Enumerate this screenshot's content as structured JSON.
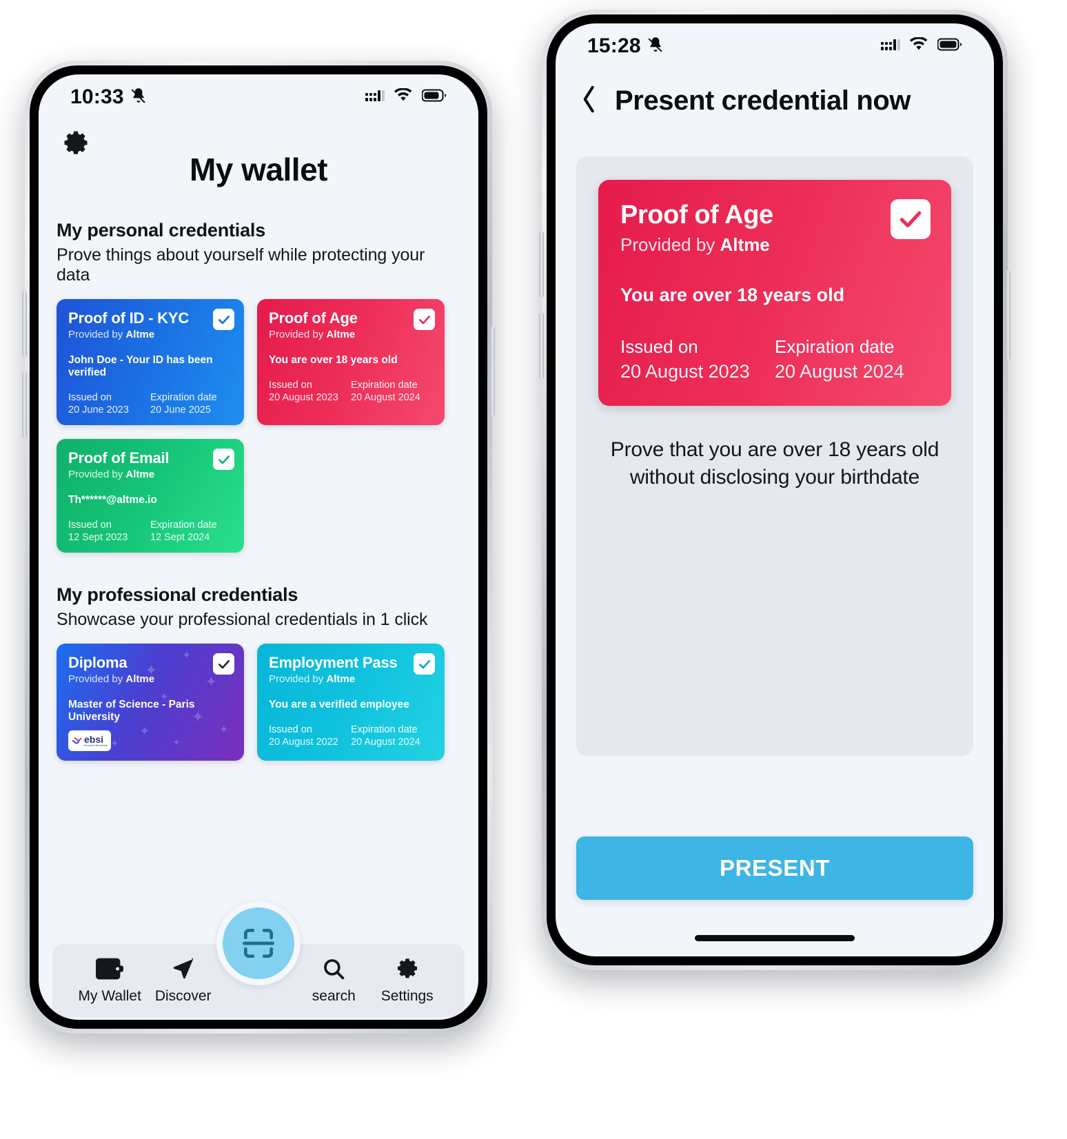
{
  "phone1": {
    "status_bar": {
      "time": "10:33",
      "icons": [
        "bell-muted-icon",
        "cellular-signal-icon",
        "wifi-icon",
        "battery-icon"
      ]
    },
    "settings_icon": "gear-icon",
    "title": "My wallet",
    "sections": [
      {
        "heading": "My personal credentials",
        "subheading": "Prove things about yourself while protecting your data",
        "cards": [
          {
            "title": "Proof of ID - KYC",
            "provider_prefix": "Provided by ",
            "provider": "Altme",
            "claim": "John Doe - Your ID has been verified",
            "issued_label": "Issued on",
            "issued_value": "20 June 2023",
            "expiration_label": "Expiration date",
            "expiration_value": "20 June 2025",
            "theme": "blue",
            "accent": "#1b6fe2",
            "checked": true
          },
          {
            "title": "Proof of Age",
            "provider_prefix": "Provided by ",
            "provider": "Altme",
            "claim": "You are over 18 years old",
            "issued_label": "Issued on",
            "issued_value": "20 August 2023",
            "expiration_label": "Expiration date",
            "expiration_value": "20 August 2024",
            "theme": "red",
            "accent": "#ec2c56",
            "checked": true
          },
          {
            "title": "Proof of Email",
            "provider_prefix": "Provided by ",
            "provider": "Altme",
            "claim": "Th******@altme.io",
            "issued_label": "Issued on",
            "issued_value": "12 Sept 2023",
            "expiration_label": "Expiration date",
            "expiration_value": "12 Sept 2024",
            "theme": "green",
            "accent": "#14c377",
            "checked": true
          }
        ]
      },
      {
        "heading": "My professional credentials",
        "subheading": "Showcase your professional credentials in 1 click",
        "cards": [
          {
            "title": "Diploma",
            "provider_prefix": "Provided by ",
            "provider": "Altme",
            "claim": "Master of Science - Paris University",
            "badge": "ebsi",
            "badge_sub": "European Blockchain",
            "theme": "purple",
            "accent": "#4a3fd0",
            "checked": true
          },
          {
            "title": "Employment Pass",
            "provider_prefix": "Provided by ",
            "provider": "Altme",
            "claim": "You are a verified employee",
            "issued_label": "Issued on",
            "issued_value": "20 August 2022",
            "expiration_label": "Expiration date",
            "expiration_value": "20 August 2024",
            "theme": "cyan",
            "accent": "#10c2de",
            "checked": true
          }
        ]
      }
    ],
    "bottom_nav": {
      "items": [
        {
          "label": "My Wallet",
          "icon": "wallet-icon",
          "active": true
        },
        {
          "label": "Discover",
          "icon": "paper-plane-icon",
          "active": false
        },
        {
          "label": "search",
          "icon": "magnifier-icon",
          "active": false
        },
        {
          "label": "Settings",
          "icon": "gear-icon",
          "active": false
        }
      ],
      "fab": {
        "icon": "qr-scan-icon",
        "color": "#83d0f0"
      }
    }
  },
  "phone2": {
    "status_bar": {
      "time": "15:28",
      "icons": [
        "bell-muted-icon",
        "cellular-signal-icon",
        "wifi-icon",
        "battery-icon"
      ]
    },
    "back_icon": "chevron-left-icon",
    "title": "Present credential now",
    "card": {
      "title": "Proof of Age",
      "provider_prefix": "Provided by ",
      "provider": "Altme",
      "claim": "You are over 18 years old",
      "issued_label": "Issued on",
      "issued_value": "20 August 2023",
      "expiration_label": "Expiration date",
      "expiration_value": "20 August 2024",
      "accent": "#ec2c56",
      "checked": true
    },
    "description": "Prove that you are over 18 years old without disclosing your birthdate",
    "present_label": "PRESENT",
    "present_color": "#3db5e5"
  }
}
